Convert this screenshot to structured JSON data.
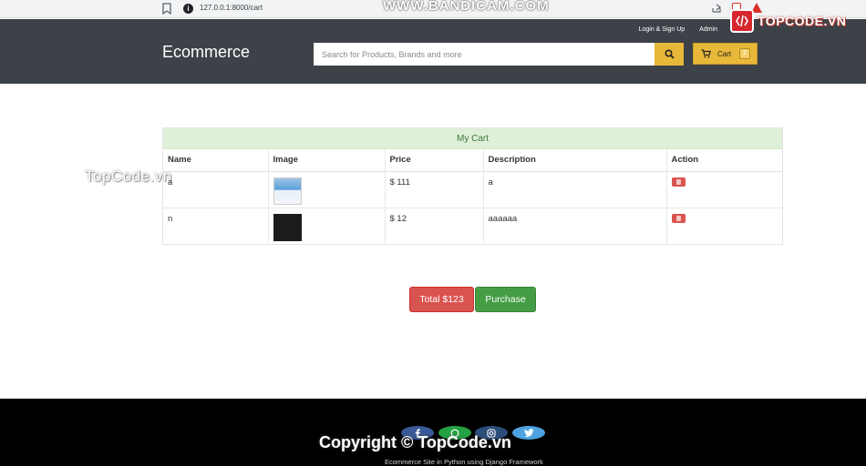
{
  "browser": {
    "url": "127.0.0.1:8000/cart",
    "recorder_watermark": "WWW.BANDICAM.COM"
  },
  "header": {
    "brand": "Ecommerce",
    "login_signup": "Login & Sign Up",
    "admin": "Admin",
    "search_placeholder": "Search for Products, Brands and more",
    "cart_label": "Cart",
    "cart_count": "2"
  },
  "watermarks": {
    "logo_text": "TOPCODE.VN",
    "left_text": "TopCode.vn"
  },
  "cart": {
    "title": "My Cart",
    "columns": [
      "Name",
      "Image",
      "Price",
      "Description",
      "Action"
    ],
    "rows": [
      {
        "name": "a",
        "price": "$ 111",
        "description": "a"
      },
      {
        "name": "n",
        "price": "$ 12",
        "description": "aaaaaa"
      }
    ]
  },
  "actions": {
    "total_label": "Total $123",
    "purchase_label": "Purchase"
  },
  "footer": {
    "copyright": "Copyright © TopCode.vn",
    "tagline": "Ecommerce Site in Python using Django Framework"
  },
  "colors": {
    "header_bg": "#3d4148",
    "accent_yellow": "#e8b83a",
    "cart_title_bg": "#dff0d8",
    "danger": "#d9534f",
    "success": "#449d44",
    "footer_bg": "#000000"
  }
}
